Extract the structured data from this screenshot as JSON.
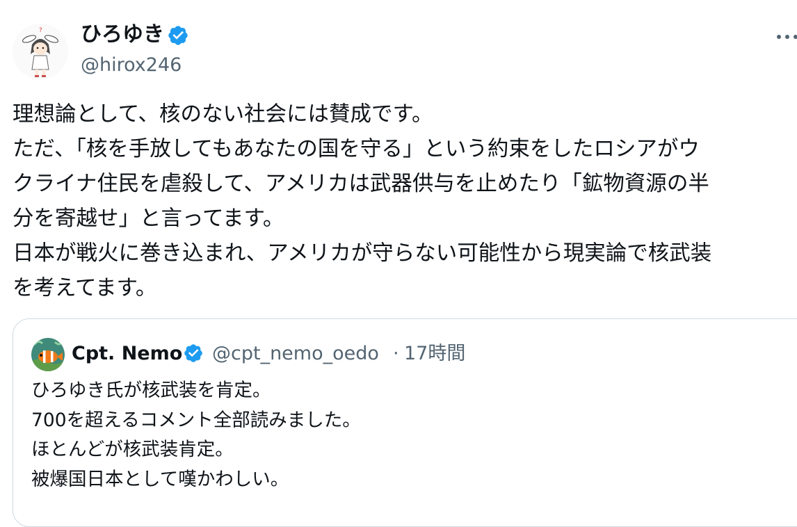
{
  "author": {
    "display_name": "ひろゆき",
    "handle": "@hirox246",
    "verified": true,
    "avatar_icon": "avatar-illustration-icon"
  },
  "tweet": {
    "lines": [
      "理想論として、核のない社会には賛成です。",
      "ただ、「核を手放してもあなたの国を守る」という約束をしたロシアがウ",
      "クライナ住民を虐殺して、アメリカは武器供与を止めたり「鉱物資源の半",
      "分を寄越せ」と言ってます。",
      "日本が戦火に巻き込まれ、アメリカが守らない可能性から現実論で核武装",
      "を考えてます。"
    ]
  },
  "quoted_tweet": {
    "display_name": "Cpt. Nemo",
    "handle": "@cpt_nemo_oedo",
    "separator": "·",
    "time": "17時間",
    "verified": true,
    "avatar_icon": "clownfish-avatar-icon",
    "lines": [
      "ひろゆき氏が核武装を肯定。",
      "700を超えるコメント全部読みました。",
      "ほとんどが核武装肯定。",
      "被爆国日本として嘆かわしい。"
    ]
  },
  "colors": {
    "text": "#0f1419",
    "secondary_text": "#536471",
    "verified_blue": "#1d9bf0",
    "border": "#cfd9de",
    "background": "#ffffff"
  }
}
